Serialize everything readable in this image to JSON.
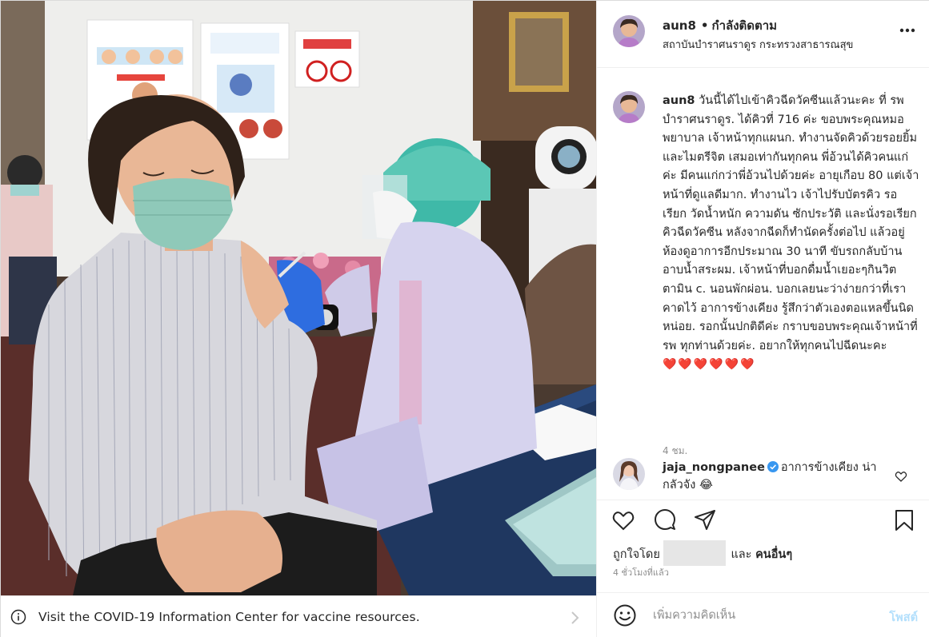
{
  "header": {
    "username": "aun8",
    "separator": "•",
    "follow_state": "กำลังติดตาม",
    "location": "สถาบันบำราศนราดูร กระทรวงสาธารณสุข"
  },
  "caption": {
    "username": "aun8",
    "text": " วันนี้ได้ไปเข้าคิวฉีดวัคซีนแล้วนะคะ ที่ รพ บำราศนราดูร. ได้คิวที่ 716 ค่ะ ขอบพระคุณหมอพยาบาล เจ้าหน้าทุกแผนก. ทำงานจัดคิวด้วยรอยยิ้มและไมตรีจิต เสมอเท่ากันทุกคน พี่อ้วนได้คิวคนแก่ค่ะ มีคนแก่กว่าพี่อ้วนไปด้วยค่ะ อายุเกือบ 80 แต่เจ้าหน้าที่ดูแลดีมาก. ทำงานไว เจ้าไปรับบัตรคิว รอเรียก วัดน้ำหนัก ความดัน ซักประวัติ และนั่งรอเรียกคิวฉีดวัคซีน หลังจากฉีดก็ทำนัดครั้งต่อไป แล้วอยู่ห้องดูอาการอีกประมาณ 30 นาที ขับรถกลับบ้าน อาบน้ำสระผม. เจ้าหน้าที่บอกดื่มน้ำเยอะๆกินวิตตามิน c. นอนพักผ่อน. บอกเลยนะว่าง่ายกว่าที่เราคาดไว้ อาการข้างเคียง รู้สึกว่าตัวเองตอแหลขึ้นนิดหน่อย. รอกนั้นปกติดีค่ะ กราบขอบพระคุณเจ้าหน้าที่ รพ ทุกท่านด้วยค่ะ. อยากให้ทุกคนไปฉีดนะคะ ",
    "hearts": "❤️❤️❤️❤️❤️❤️",
    "time": "4 ชม."
  },
  "reply": {
    "username": "jaja_nongpanee",
    "text": "อาการข้างเคียง น่ากลัวจัง 😂"
  },
  "likes": {
    "prefix": "ถูกใจโดย ",
    "joiner": "และ ",
    "others": "คนอื่นๆ"
  },
  "post_time": "4 ชั่วโมงที่แล้ว",
  "comment_box": {
    "placeholder": "เพิ่มความคิดเห็น",
    "post_label": "โพสต์"
  },
  "covid_banner": {
    "text": "Visit the COVID-19 Information Center for vaccine resources."
  },
  "icons": {
    "more": "more-options-icon",
    "like": "heart-outline-icon",
    "comment": "comment-bubble-icon",
    "share": "paper-plane-icon",
    "save": "bookmark-icon",
    "emoji": "smiley-icon",
    "info": "info-circle-icon",
    "chevron": "chevron-right-icon",
    "verified": "verified-badge-icon"
  },
  "colors": {
    "post_button_disabled": "#b2dffc",
    "secondary_text": "#8e8e8e",
    "verified_blue": "#3897f0",
    "heart_red": "#ed4956"
  }
}
